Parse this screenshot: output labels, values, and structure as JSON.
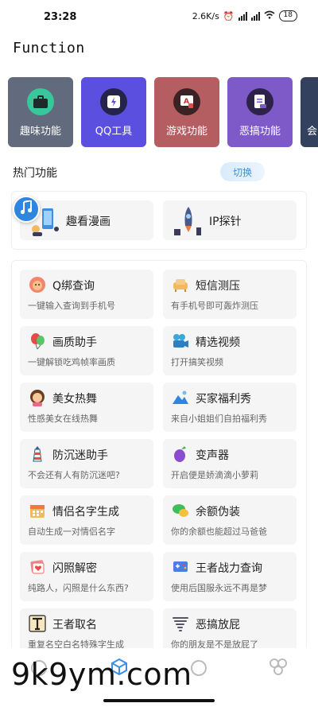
{
  "status_bar": {
    "time": "23:28",
    "speed": "2.6K/s",
    "battery": "18"
  },
  "app": {
    "title": "Function"
  },
  "categories": [
    {
      "label": "趣味功能",
      "color": "#626b7d",
      "icon": "briefcase-icon"
    },
    {
      "label": "QQ工具",
      "color": "#5b4fe0",
      "icon": "lightning-icon"
    },
    {
      "label": "游戏功能",
      "color": "#b45e62",
      "icon": "ad-tablet-icon"
    },
    {
      "label": "恶搞功能",
      "color": "#7e5ac9",
      "icon": "document-icon"
    },
    {
      "label": "会",
      "color": "#33405e",
      "icon": "partial-icon"
    }
  ],
  "hot": {
    "title": "热门功能",
    "switch_label": "切换",
    "items": [
      {
        "label": "趣看漫画",
        "icon": "comic-phone-icon"
      },
      {
        "label": "IP探针",
        "icon": "rocket-icon"
      }
    ]
  },
  "functions": [
    {
      "title": "Q绑查询",
      "desc": "一键输入查询到手机号",
      "icon": "lion-icon"
    },
    {
      "title": "短信测压",
      "desc": "有手机号即可轰炸测压",
      "icon": "sofa-icon"
    },
    {
      "title": "画质助手",
      "desc": "一键解锁吃鸡帧率画质",
      "icon": "balloon-icon"
    },
    {
      "title": "精选视频",
      "desc": "打开搞笑视频",
      "icon": "video-camera-icon"
    },
    {
      "title": "美女热舞",
      "desc": "性感美女在线热舞",
      "icon": "girl-icon"
    },
    {
      "title": "买家福利秀",
      "desc": "来自小姐姐们自拍福利秀",
      "icon": "mountain-photo-icon"
    },
    {
      "title": "防沉迷助手",
      "desc": "不会还有人有防沉迷吧?",
      "icon": "lighthouse-icon"
    },
    {
      "title": "变声器",
      "desc": "开启便是娇滴滴小萝莉",
      "icon": "eggplant-icon"
    },
    {
      "title": "情侣名字生成",
      "desc": "自动生成一对情侣名字",
      "icon": "calendar-icon"
    },
    {
      "title": "余额伪装",
      "desc": "你的余额也能超过马爸爸",
      "icon": "chat-bubbles-icon"
    },
    {
      "title": "闪照解密",
      "desc": "纯路人，闪照是什么东西?",
      "icon": "heart-photo-icon"
    },
    {
      "title": "王者战力查询",
      "desc": "使用后国服永远不再是梦",
      "icon": "gamepad-icon"
    },
    {
      "title": "王者取名",
      "desc": "重复名空白名特殊字生成",
      "icon": "text-t-icon"
    },
    {
      "title": "恶搞放屁",
      "desc": "你的朋友是不是放屁了",
      "icon": "tornado-icon"
    }
  ],
  "watermark": "9k9ym.com"
}
